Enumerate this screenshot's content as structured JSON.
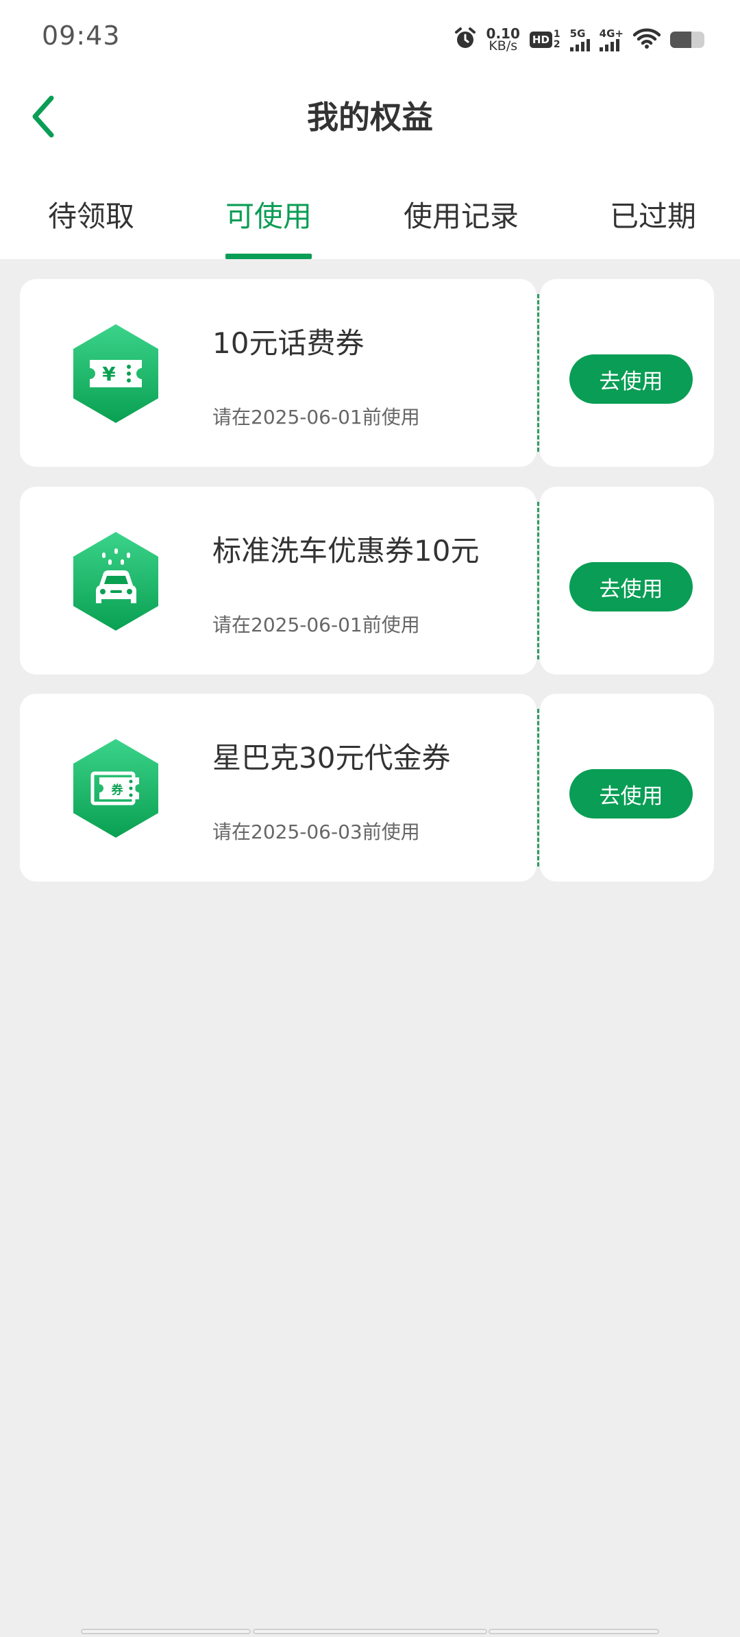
{
  "status_bar": {
    "time": "09:43",
    "net_speed_value": "0.10",
    "net_speed_unit": "KB/s",
    "hd_label": "HD",
    "hd_sup": "1",
    "hd_sub": "2",
    "signal_5g_label": "5G",
    "signal_4g_label": "4G+",
    "battery_level_percent": 62,
    "icons": [
      "alarm-icon",
      "hd-icon",
      "signal-5g-icon",
      "signal-4g-icon",
      "wifi-icon",
      "battery-icon"
    ]
  },
  "header": {
    "title": "我的权益",
    "back_icon": "chevron-left-icon"
  },
  "tabs": [
    {
      "label": "待领取",
      "active": false
    },
    {
      "label": "可使用",
      "active": true
    },
    {
      "label": "使用记录",
      "active": false
    },
    {
      "label": "已过期",
      "active": false
    }
  ],
  "coupons": [
    {
      "title": "10元话费券",
      "date": "请在2025-06-01前使用",
      "button": "去使用",
      "icon": "phone-bill-ticket-icon",
      "icon_glyph": "¥"
    },
    {
      "title": "标准洗车优惠券10元",
      "date": "请在2025-06-01前使用",
      "button": "去使用",
      "icon": "car-wash-icon"
    },
    {
      "title": "星巴克30元代金券",
      "date": "请在2025-06-03前使用",
      "button": "去使用",
      "icon": "voucher-ticket-icon",
      "icon_glyph": "券"
    }
  ],
  "colors": {
    "accent": "#0a9d55",
    "background": "#eeeeee",
    "card": "#ffffff",
    "text": "#333333",
    "muted_text": "#666666"
  }
}
